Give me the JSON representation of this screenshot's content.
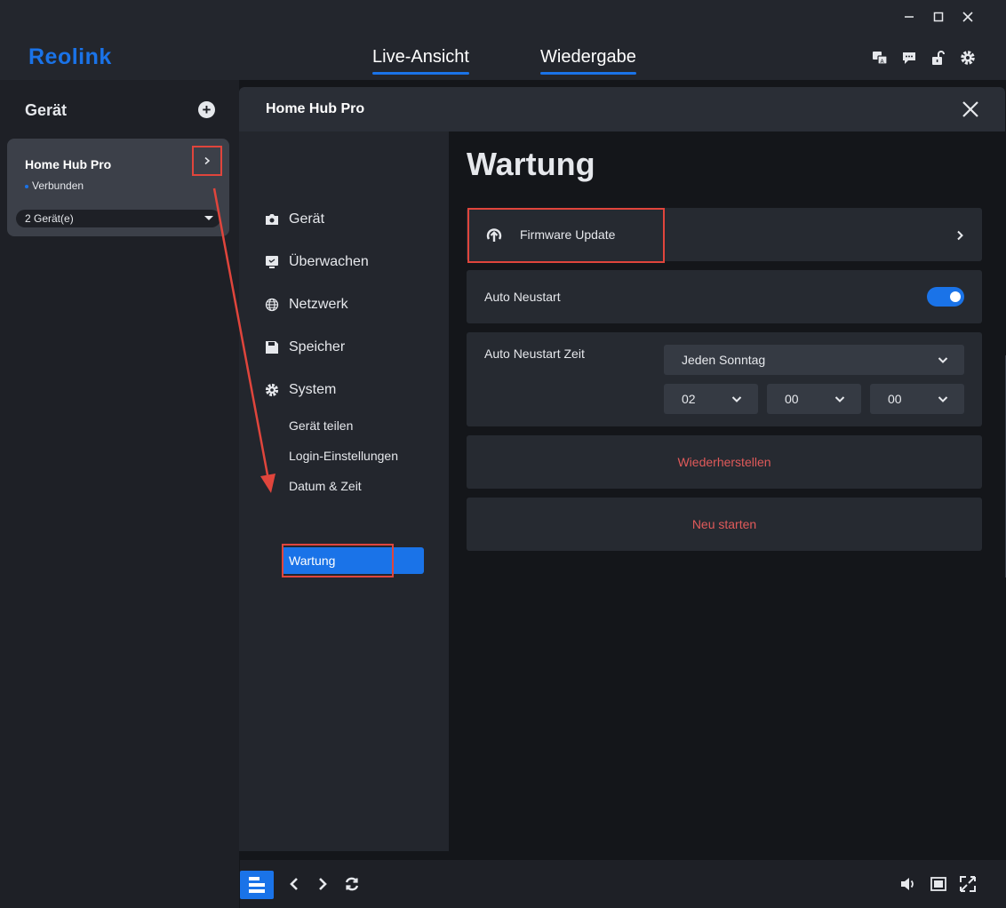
{
  "window": {
    "controls": [
      "minimize",
      "maximize",
      "close"
    ]
  },
  "header": {
    "logo": "Reolink",
    "tabs": [
      {
        "label": "Live-Ansicht"
      },
      {
        "label": "Wiedergabe"
      }
    ],
    "icons": [
      "translate-icon",
      "chat-icon",
      "unlock-icon",
      "gear-icon"
    ]
  },
  "sidebar": {
    "title": "Gerät",
    "device": {
      "name": "Home Hub Pro",
      "status": "Verbunden",
      "devices_select": "2 Gerät(e)"
    }
  },
  "dialog": {
    "title": "Home Hub Pro",
    "nav": [
      {
        "label": "Gerät",
        "icon": "camera-icon"
      },
      {
        "label": "Überwachen",
        "icon": "monitor-icon"
      },
      {
        "label": "Netzwerk",
        "icon": "globe-icon"
      },
      {
        "label": "Speicher",
        "icon": "floppy-icon"
      },
      {
        "label": "System",
        "icon": "gear-icon"
      }
    ],
    "subnav": [
      {
        "label": "Gerät teilen"
      },
      {
        "label": "Login-Einstellungen"
      },
      {
        "label": "Datum & Zeit"
      },
      {
        "label": "Wartung"
      }
    ],
    "content": {
      "title": "Wartung",
      "firmware_label": "Firmware Update",
      "auto_restart_label": "Auto Neustart",
      "auto_restart_on": true,
      "restart_time_label": "Auto Neustart Zeit",
      "restart_day": "Jeden Sonntag",
      "restart_hour": "02",
      "restart_minute": "00",
      "restart_second": "00",
      "restore_label": "Wiederherstellen",
      "reboot_label": "Neu starten"
    }
  },
  "colors": {
    "accent": "#1a73e8",
    "danger": "#e05a5a",
    "annotation": "#e0453c"
  }
}
